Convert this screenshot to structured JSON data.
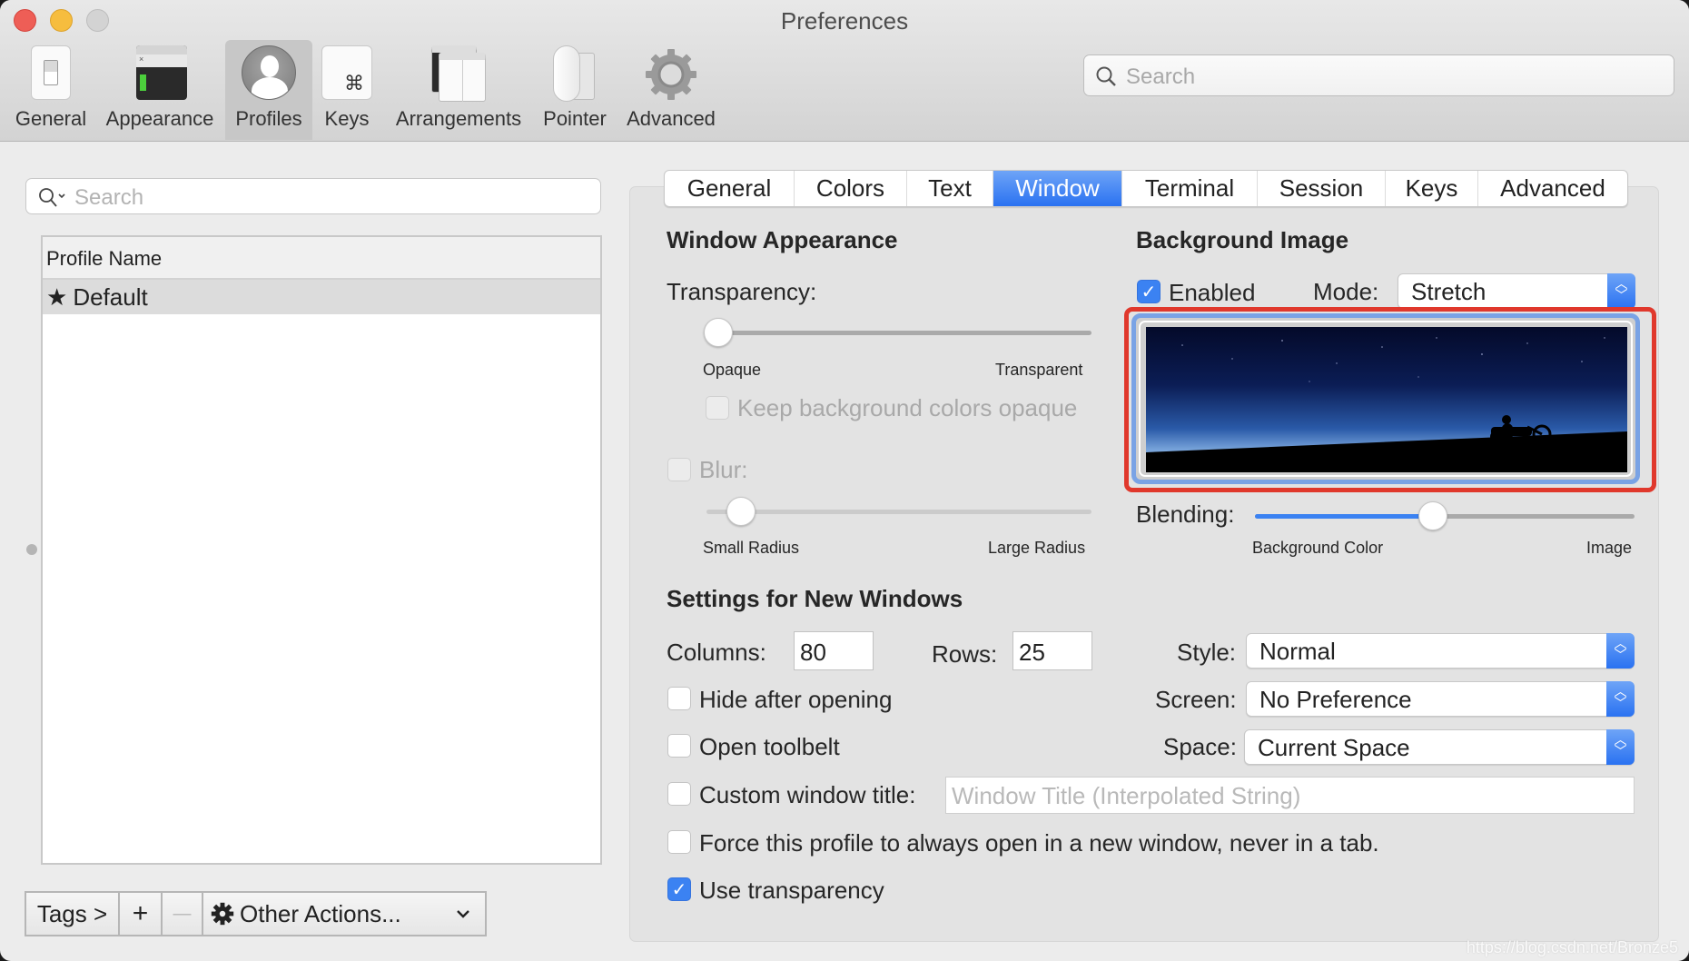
{
  "window": {
    "title": "Preferences"
  },
  "toolbar": {
    "items": [
      {
        "label": "General",
        "icon": "general-switch-icon"
      },
      {
        "label": "Appearance",
        "icon": "appearance-terminal-icon"
      },
      {
        "label": "Profiles",
        "icon": "profile-person-icon",
        "selected": true
      },
      {
        "label": "Keys",
        "icon": "command-key-icon"
      },
      {
        "label": "Arrangements",
        "icon": "arrangements-windows-icon"
      },
      {
        "label": "Pointer",
        "icon": "mouse-icon"
      },
      {
        "label": "Advanced",
        "icon": "gear-icon"
      }
    ],
    "search_placeholder": "Search"
  },
  "profiles": {
    "search_placeholder": "Search",
    "column_header": "Profile Name",
    "rows": [
      {
        "name": "Default",
        "default": true
      }
    ],
    "bottom": {
      "tags_label": "Tags >",
      "add_label": "+",
      "remove_label": "—",
      "other_actions_label": "Other Actions..."
    }
  },
  "tabs": [
    {
      "label": "General"
    },
    {
      "label": "Colors"
    },
    {
      "label": "Text"
    },
    {
      "label": "Window",
      "active": true
    },
    {
      "label": "Terminal"
    },
    {
      "label": "Session"
    },
    {
      "label": "Keys"
    },
    {
      "label": "Advanced"
    }
  ],
  "window_appearance": {
    "heading": "Window Appearance",
    "transparency_label": "Transparency:",
    "transparency_value": 0.03,
    "transparency_min_label": "Opaque",
    "transparency_max_label": "Transparent",
    "keep_bg_opaque_label": "Keep background colors opaque",
    "keep_bg_opaque_checked": false,
    "blur_label": "Blur:",
    "blur_checked": false,
    "blur_value": 0.09,
    "blur_min_label": "Small Radius",
    "blur_max_label": "Large Radius"
  },
  "background_image": {
    "heading": "Background Image",
    "enabled_label": "Enabled",
    "enabled_checked": true,
    "mode_label": "Mode:",
    "mode_value": "Stretch",
    "image_description": "Night sky with motorcyclist silhouette",
    "blending_label": "Blending:",
    "blending_value": 0.47,
    "blending_min_label": "Background Color",
    "blending_max_label": "Image"
  },
  "new_windows": {
    "heading": "Settings for New Windows",
    "columns_label": "Columns:",
    "columns_value": "80",
    "rows_label": "Rows:",
    "rows_value": "25",
    "style_label": "Style:",
    "style_value": "Normal",
    "screen_label": "Screen:",
    "screen_value": "No Preference",
    "space_label": "Space:",
    "space_value": "Current Space",
    "hide_after_opening_label": "Hide after opening",
    "hide_after_opening_checked": false,
    "open_toolbelt_label": "Open toolbelt",
    "open_toolbelt_checked": false,
    "custom_title_label": "Custom window title:",
    "custom_title_checked": false,
    "custom_title_placeholder": "Window Title (Interpolated String)",
    "force_new_window_label": "Force this profile to always open in a new window, never in a tab.",
    "force_new_window_checked": false,
    "use_transparency_label": "Use transparency",
    "use_transparency_checked": true
  },
  "colors": {
    "accent": "#2a72f1",
    "highlight_box": "#e0382c"
  },
  "watermark": "https://blog.csdn.net/Bronze5"
}
